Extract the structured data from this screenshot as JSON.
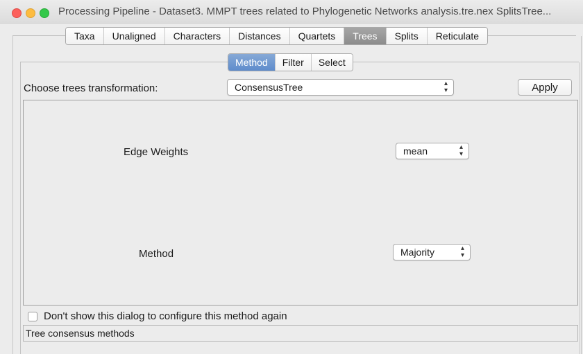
{
  "window": {
    "title": "Processing Pipeline - Dataset3. MMPT trees related to Phylogenetic Networks analysis.tre.nex SplitsTree..."
  },
  "main_tabs": [
    {
      "label": "Taxa"
    },
    {
      "label": "Unaligned"
    },
    {
      "label": "Characters"
    },
    {
      "label": "Distances"
    },
    {
      "label": "Quartets"
    },
    {
      "label": "Trees",
      "selected": true
    },
    {
      "label": "Splits"
    },
    {
      "label": "Reticulate"
    }
  ],
  "sub_tabs": [
    {
      "label": "Method",
      "selected": true
    },
    {
      "label": "Filter"
    },
    {
      "label": "Select"
    }
  ],
  "transform": {
    "label": "Choose trees transformation:",
    "value": "ConsensusTree",
    "apply_label": "Apply"
  },
  "options": {
    "edge_weights": {
      "label": "Edge Weights",
      "value": "mean"
    },
    "method": {
      "label": "Method",
      "value": "Majority"
    }
  },
  "dont_show": {
    "label": "Don't show this dialog to configure this method again",
    "checked": false
  },
  "status": {
    "text": "Tree consensus methods"
  },
  "colors": {
    "selected_tab": "#8c8c8c",
    "selected_subtab": "#5f8ccc"
  }
}
